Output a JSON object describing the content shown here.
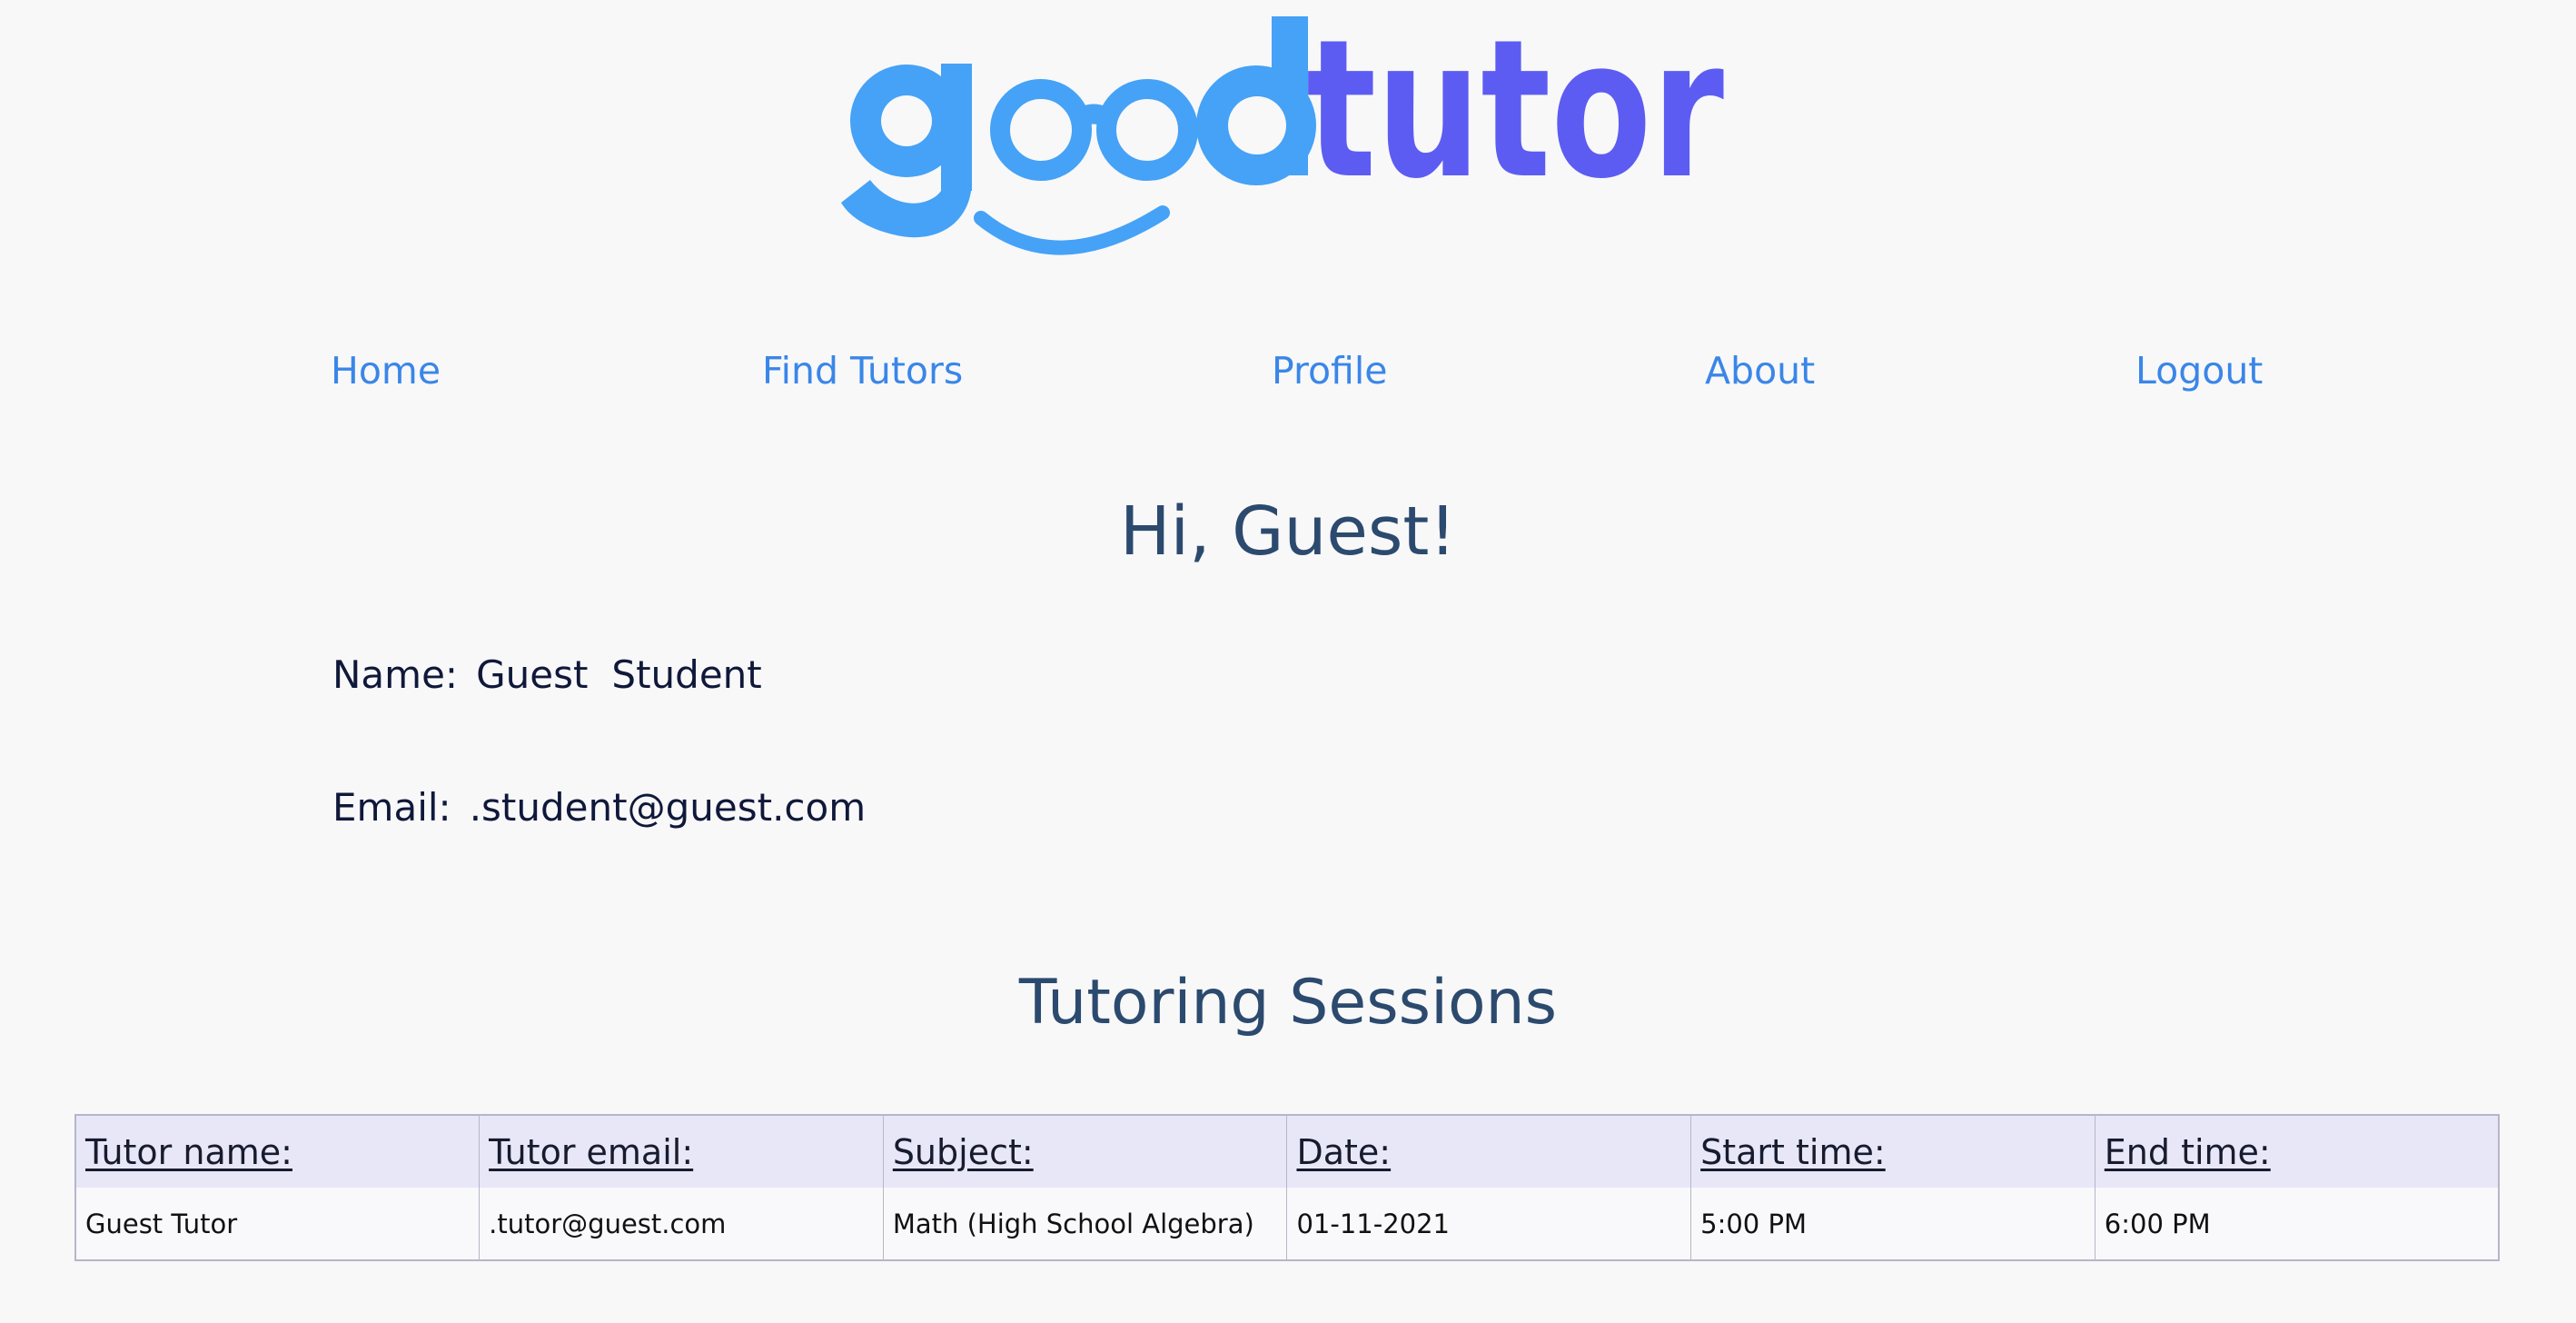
{
  "logo": {
    "part1": "goo",
    "part2": "d",
    "part3": "tutor",
    "colors": {
      "light": "#45a2f6",
      "dark": "#5d5cf2"
    }
  },
  "nav": {
    "items": [
      {
        "label": "Home"
      },
      {
        "label": "Find Tutors"
      },
      {
        "label": "Profile"
      },
      {
        "label": "About"
      },
      {
        "label": "Logout"
      }
    ]
  },
  "greeting": "Hi, Guest!",
  "profile": {
    "name_label": "Name:",
    "first_name": "Guest",
    "last_name": "Student",
    "email_label": "Email:",
    "email": ".student@guest.com"
  },
  "sessions": {
    "title": "Tutoring Sessions",
    "columns": [
      "Tutor name:",
      "Tutor email:",
      "Subject:",
      "Date:",
      "Start time:",
      "End time:"
    ],
    "rows": [
      {
        "tutor_name": "Guest Tutor",
        "tutor_email": ".tutor@guest.com",
        "subject": "Math (High School Algebra)",
        "date": "01-11-2021",
        "start": "5:00 PM",
        "end": "6:00 PM"
      }
    ]
  }
}
